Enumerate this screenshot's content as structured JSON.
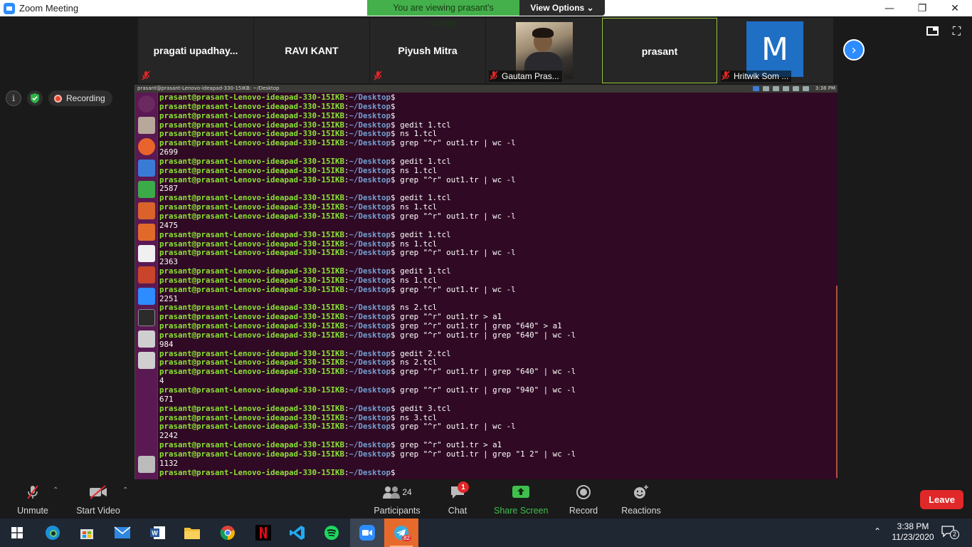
{
  "window": {
    "title": "Zoom Meeting"
  },
  "banner": {
    "viewing_text": "You are viewing prasant's screen",
    "view_options_label": "View Options ⌄"
  },
  "participants_strip": [
    {
      "name": "pragati  upadhay...",
      "style": "center",
      "muted": true
    },
    {
      "name": "RAVI KANT",
      "style": "center",
      "muted": false
    },
    {
      "name": "Piyush Mitra",
      "style": "center",
      "muted": true
    },
    {
      "name": "Gautam Pras...",
      "style": "photo",
      "muted": true
    },
    {
      "name": "prasant",
      "style": "center",
      "muted": false,
      "active": true
    },
    {
      "name": "Hritwik Som ...",
      "style": "avatar",
      "avatar_letter": "M",
      "muted": true
    }
  ],
  "status": {
    "recording_label": "Recording"
  },
  "shared_screen": {
    "topbar_title": "prasant@prasant-Lenovo-ideapad-330-15IKB: ~/Desktop",
    "clock": "3:38 PM",
    "prompt_user": "prasant@prasant-Lenovo-ideapad-330-15IKB",
    "prompt_path": "~/Desktop",
    "lines": [
      {
        "t": "p",
        "cmd": ""
      },
      {
        "t": "p",
        "cmd": ""
      },
      {
        "t": "p",
        "cmd": ""
      },
      {
        "t": "p",
        "cmd": " gedit 1.tcl"
      },
      {
        "t": "p",
        "cmd": " ns 1.tcl"
      },
      {
        "t": "p",
        "cmd": " grep \"^r\" out1.tr | wc -l"
      },
      {
        "t": "o",
        "text": "2699"
      },
      {
        "t": "p",
        "cmd": " gedit 1.tcl"
      },
      {
        "t": "p",
        "cmd": " ns 1.tcl"
      },
      {
        "t": "p",
        "cmd": " grep \"^r\" out1.tr | wc -l"
      },
      {
        "t": "o",
        "text": "2587"
      },
      {
        "t": "p",
        "cmd": " gedit 1.tcl"
      },
      {
        "t": "p",
        "cmd": " ns 1.tcl"
      },
      {
        "t": "p",
        "cmd": " grep \"^r\" out1.tr | wc -l"
      },
      {
        "t": "o",
        "text": "2475"
      },
      {
        "t": "p",
        "cmd": " gedit 1.tcl"
      },
      {
        "t": "p",
        "cmd": " ns 1.tcl"
      },
      {
        "t": "p",
        "cmd": " grep \"^r\" out1.tr | wc -l"
      },
      {
        "t": "o",
        "text": "2363"
      },
      {
        "t": "p",
        "cmd": " gedit 1.tcl"
      },
      {
        "t": "p",
        "cmd": " ns 1.tcl"
      },
      {
        "t": "p",
        "cmd": " grep \"^r\" out1.tr | wc -l"
      },
      {
        "t": "o",
        "text": "2251"
      },
      {
        "t": "p",
        "cmd": " ns 2.tcl"
      },
      {
        "t": "p",
        "cmd": " grep \"^r\" out1.tr > a1"
      },
      {
        "t": "p",
        "cmd": " grep \"^r\" out1.tr | grep \"640\" > a1"
      },
      {
        "t": "p",
        "cmd": " grep \"^r\" out1.tr | grep \"640\" | wc -l"
      },
      {
        "t": "o",
        "text": "984"
      },
      {
        "t": "p",
        "cmd": " gedit 2.tcl"
      },
      {
        "t": "p",
        "cmd": " ns 2.tcl"
      },
      {
        "t": "p",
        "cmd": " grep \"^r\" out1.tr | grep \"640\" | wc -l"
      },
      {
        "t": "o",
        "text": "4"
      },
      {
        "t": "p",
        "cmd": " grep \"^r\" out1.tr | grep \"940\" | wc -l"
      },
      {
        "t": "o",
        "text": "671"
      },
      {
        "t": "p",
        "cmd": " gedit 3.tcl"
      },
      {
        "t": "p",
        "cmd": " ns 3.tcl"
      },
      {
        "t": "p",
        "cmd": " grep \"^r\" out1.tr | wc -l"
      },
      {
        "t": "o",
        "text": "2242"
      },
      {
        "t": "p",
        "cmd": " grep \"^r\" out1.tr > a1"
      },
      {
        "t": "p",
        "cmd": " grep \"^r\" out1.tr | grep \"1 2\" | wc -l"
      },
      {
        "t": "o",
        "text": "1132"
      },
      {
        "t": "p",
        "cmd": ""
      }
    ]
  },
  "toolbar": {
    "unmute_label": "Unmute",
    "start_video_label": "Start Video",
    "participants_label": "Participants",
    "participants_count": "24",
    "chat_label": "Chat",
    "chat_badge": "1",
    "share_screen_label": "Share Screen",
    "record_label": "Record",
    "reactions_label": "Reactions",
    "leave_label": "Leave"
  },
  "taskbar": {
    "time": "3:38 PM",
    "date": "11/23/2020",
    "notification_count": "2",
    "telegram_badge": "82"
  },
  "colors": {
    "share_green": "#3fbf4c",
    "leave_red": "#e02828",
    "terminal_bg": "#300a24",
    "prompt_green": "#8ae234",
    "prompt_blue": "#729fcf"
  }
}
